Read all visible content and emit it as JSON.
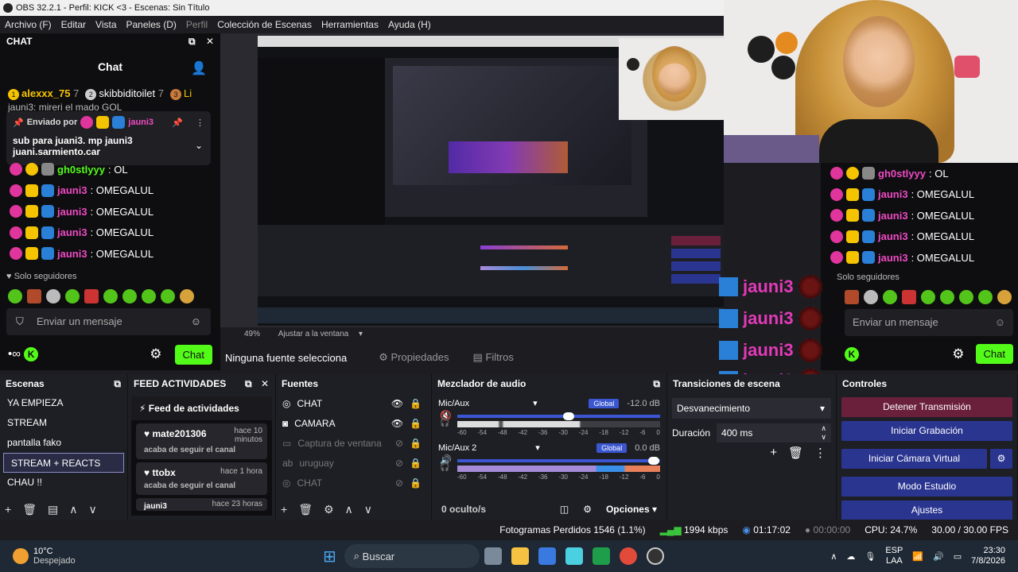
{
  "window": {
    "title": "OBS 32.2.1 - Perfil: KICK <3 - Escenas: Sin Título"
  },
  "menu": [
    "Archivo (F)",
    "Editar",
    "Vista",
    "Paneles (D)",
    "Perfil",
    "Colección de Escenas",
    "Herramientas",
    "Ayuda (H)"
  ],
  "chat": {
    "dock_title": "CHAT",
    "title": "Chat",
    "gifters": [
      {
        "rank": "1",
        "name": "alexxx_75",
        "count": "7"
      },
      {
        "rank": "2",
        "name": "skibbiditoilet",
        "count": "7"
      },
      {
        "rank": "3",
        "name": "Li",
        "count": ""
      }
    ],
    "behind_pinned": "jauni3: mireri el mado GOL",
    "pinned_by_label": "Enviado por",
    "pinned_user": "jauni3",
    "pinned_message": "sub para juani3. mp jauni3 juani.sarmiento.car",
    "messages": [
      {
        "user": "gh0stlyyy",
        "text": ": OL"
      },
      {
        "user": "jauni3",
        "text": ": OMEGALUL"
      },
      {
        "user": "jauni3",
        "text": ": OMEGALUL"
      },
      {
        "user": "jauni3",
        "text": ": OMEGALUL"
      },
      {
        "user": "jauni3",
        "text": ": OMEGALUL"
      }
    ],
    "followers_only": "Solo seguidores",
    "input_placeholder": "Enviar un mensaje",
    "chat_button": "Chat"
  },
  "right_chat": {
    "messages": [
      {
        "user": "gh0stlyyy",
        "text": ": OL"
      },
      {
        "user": "jauni3",
        "text": ": OMEGALUL"
      },
      {
        "user": "jauni3",
        "text": ": OMEGALUL"
      },
      {
        "user": "jauni3",
        "text": ": OMEGALUL"
      },
      {
        "user": "jauni3",
        "text": ": OMEGALUL"
      }
    ],
    "followers_only": "Solo seguidores",
    "input_placeholder": "Enviar un mensaje",
    "chat_button": "Chat"
  },
  "overlay_names": [
    "jauni3",
    "jauni3",
    "jauni3",
    "jauni3"
  ],
  "preview": {
    "zoom": "49%",
    "fit_label": "Ajustar a la ventana",
    "no_source": "Ninguna fuente selecciona",
    "properties": "Propiedades",
    "filters": "Filtros"
  },
  "scenes": {
    "title": "Escenas",
    "items": [
      "YA EMPIEZA",
      "STREAM",
      "pantalla fako",
      "STREAM + REACTS",
      "CHAU !!"
    ],
    "selected_index": 3
  },
  "feed": {
    "title": "FEED ACTIVIDADES",
    "header": "Feed de actividades",
    "events": [
      {
        "user": "mate201306",
        "action": "acaba de seguir el canal",
        "time": "hace 10 minutos"
      },
      {
        "user": "ttobx",
        "action": "acaba de seguir el canal",
        "time": "hace 1 hora"
      },
      {
        "user": "jauni3",
        "action": "",
        "time": "hace 23 horas"
      }
    ]
  },
  "sources": {
    "title": "Fuentes",
    "items": [
      {
        "name": "CHAT",
        "icon": "globe-icon",
        "dim": false
      },
      {
        "name": "CAMARA",
        "icon": "camera-icon",
        "dim": false
      },
      {
        "name": "Captura de ventana",
        "icon": "window-icon",
        "dim": true
      },
      {
        "name": "uruguay",
        "icon": "text-icon",
        "dim": true
      },
      {
        "name": "CHAT",
        "icon": "globe-icon",
        "dim": true
      }
    ]
  },
  "mixer": {
    "title": "Mezclador de audio",
    "channels": [
      {
        "name": "Mic/Aux",
        "global": "Global",
        "db": "-12.0 dB",
        "level": 0.55,
        "muted": true
      },
      {
        "name": "Mic/Aux 2",
        "global": "Global",
        "db": "0.0 dB",
        "level": 0.97,
        "muted": false
      }
    ],
    "ticks": [
      "-60",
      "-54",
      "-48",
      "-42",
      "-36",
      "-30",
      "-24",
      "-18",
      "-12",
      "-6",
      "0"
    ],
    "hidden": "0 oculto/s",
    "options": "Opciones"
  },
  "transitions": {
    "title": "Transiciones de escena",
    "selected": "Desvanecimiento",
    "duration_label": "Duración",
    "duration_value": "400 ms"
  },
  "controls": {
    "title": "Controles",
    "buttons": [
      "Detener Transmisión",
      "Iniciar Grabación",
      "Iniciar Cámara Virtual",
      "Modo Estudio",
      "Ajustes"
    ]
  },
  "status": {
    "dropped": "Fotogramas Perdidos 1546 (1.1%)",
    "bitrate": "1994 kbps",
    "stream_time": "01:17:02",
    "record_time": "00:00:00",
    "cpu": "CPU: 24.7%",
    "fps": "30.00 / 30.00 FPS"
  },
  "taskbar": {
    "weather_temp": "10°C",
    "weather_desc": "Despejado",
    "search": "Buscar",
    "lang": "ESP",
    "region": "LAA",
    "time": "23:30",
    "date": "7/8/2026"
  },
  "colors": {
    "kick_green": "#53fc18",
    "pink_name": "#f04ac4",
    "accent_blue": "#2a3590",
    "stop_red": "#6a1f3b"
  }
}
